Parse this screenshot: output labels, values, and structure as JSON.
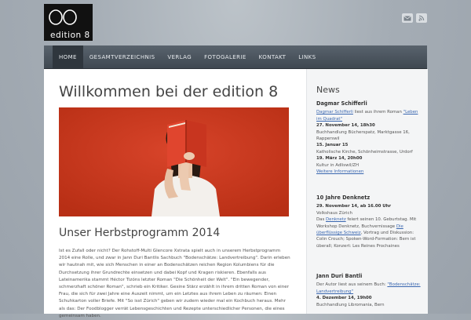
{
  "logo": {
    "text": "edition 8"
  },
  "header_icons": [
    "mail-icon",
    "rss-icon"
  ],
  "nav": {
    "items": [
      "HOME",
      "GESAMTVERZEICHNIS",
      "VERLAG",
      "FOTOGALERIE",
      "KONTAKT",
      "LINKS"
    ],
    "active": "HOME"
  },
  "main": {
    "title": "Willkommen bei der edition 8",
    "section_title": "Unser Herbstprogramm 2014",
    "body": "Ist es Zufall oder nicht? Der Rohstoff-Multi Glencore Xstrata spielt auch in unserem Herbstprogramm 2014 eine Rolle, und zwar in Jann Duri Bantlis Sachbuch \"Bodenschätze: Landvertreibung\". Darin erleben wir hautnah mit, wie sich Menschen in einer an Bodenschätzen reichen Region Kolumbiens für die Durchsetzung ihrer Grundrechte einsetzen und dabei Kopf und Kragen riskieren. Ebenfalls aus Lateinamerika stammt Héctor Tizóns letzter Roman \"Die Schönheit der Welt\". \"Ein bewegender, schmerzhaft schöner Roman\", schrieb ein Kritiker. Gesine Stärz erzählt in ihrem dritten Roman von einer Frau, die sich für zwei Jahre eine Auszeit nimmt, um ein Letztes aus ihrem Leben zu räumen: Einen Schuhkarton voller Briefe. Mit \"So isst Zürich\" geben wir zudem wieder mal ein Kochbuch heraus. Mehr als das: Der Foodblogger verrät Lebensgeschichten und Rezepte unterschiedlicher Personen, die eines gemeinsam haben."
  },
  "sidebar": {
    "title": "News",
    "news": [
      {
        "title": "Dagmar Schifferli",
        "intro_link": "Dagmar Schifferli",
        "intro_text": " liest aus ihrem Roman ",
        "intro_link2": "\"Leben im Quadrat\"",
        "events": [
          {
            "date": "27. November 14, 18h30",
            "place": "Buchhandlung Bücherspatz, Marktgasse 16, Rapperswil"
          },
          {
            "date": "15. Januar 15",
            "place": "Katholische Kirche, Schönheimstrasse, Urdorf"
          },
          {
            "date": "19. März 14, 20h00",
            "place": "Kultur in Adliswil/ZH"
          }
        ],
        "more": "Weitere Informationen"
      },
      {
        "title": "10 Jahre Denknetz",
        "date": "29. November 14, ab 16.00 Uhr",
        "place": "Volkshaus Zürich",
        "text_pre": "Das ",
        "text_link": "Denknetz",
        "text_mid": " feiert seinen 10. Geburtstag. Mit Workshop Denknetz, Buchvernissage ",
        "text_link2": "Die überflüssige Schweiz",
        "text_post": ", Vortrag und Diskussion: Colin Crouch; Spoken-Word-Formation: Bern ist überall; Konzert: Les Reines Prochaines"
      },
      {
        "title": "Jann Duri Bantli",
        "text_pre": "Der Autor liest aus seinem Buch: ",
        "text_link": "\"Bodenschätze: Landvertreibung\"",
        "date": "4. Dezember 14, 19h00",
        "place": "Buchhandlung Libromania, Bern"
      }
    ]
  },
  "colors": {
    "nav_bg": "#48525b",
    "link": "#3a67b0",
    "hero_red": "#cd381b",
    "book_red": "#d9442c"
  }
}
